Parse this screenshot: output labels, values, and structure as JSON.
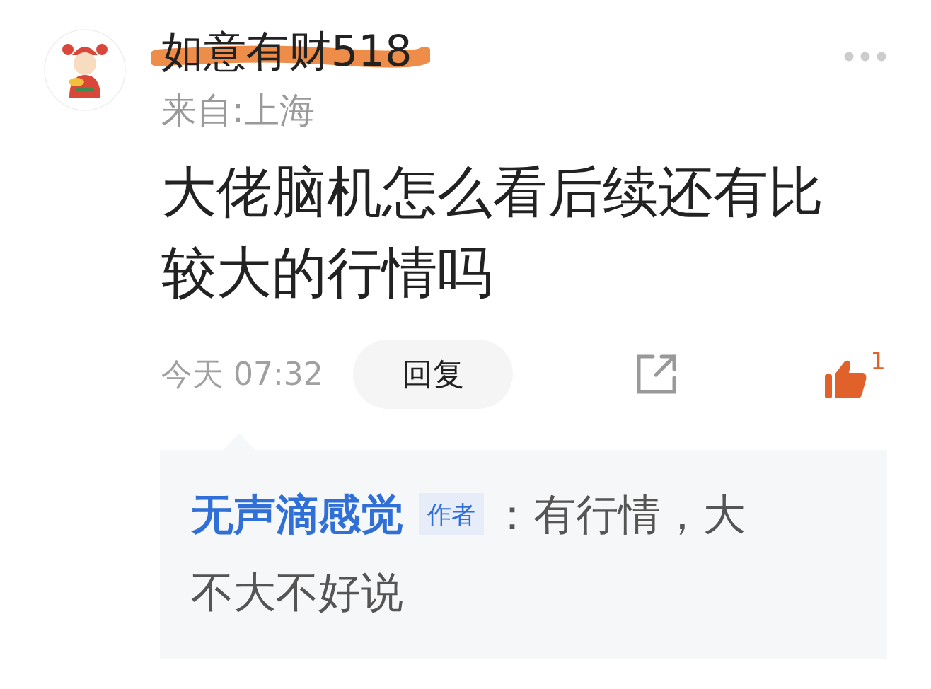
{
  "comment": {
    "author": "如意有财518",
    "author_struck": true,
    "location": "来自:上海",
    "text": "大佬脑机怎么看后续还有比较大的行情吗",
    "time": "今天 07:32",
    "reply_button": "回复",
    "likes": "1",
    "liked": true
  },
  "reply": {
    "author": "无声滴感觉",
    "badge": "作者",
    "text_lines": [
      "：有行情，大",
      "不大不好说"
    ]
  }
}
